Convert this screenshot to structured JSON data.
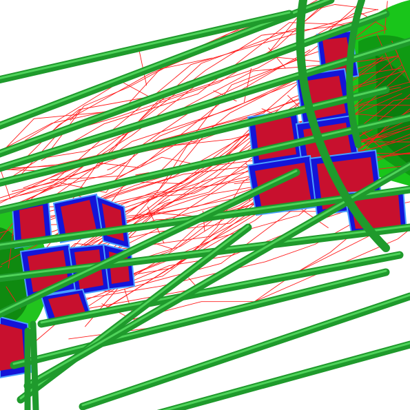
{
  "scene": {
    "description_text": "",
    "colors": {
      "background": "#ffffff",
      "support_rod": "#1f9a2c",
      "support_rod_highlight": "#4fd35a",
      "end_cap": "#22c41e",
      "end_cap_dark": "#0f7f10",
      "wire_frame": "#ff1a1a",
      "module_blue": "#1414d8",
      "module_red": "#c8102e",
      "module_edge": "#4aa0ff"
    }
  }
}
